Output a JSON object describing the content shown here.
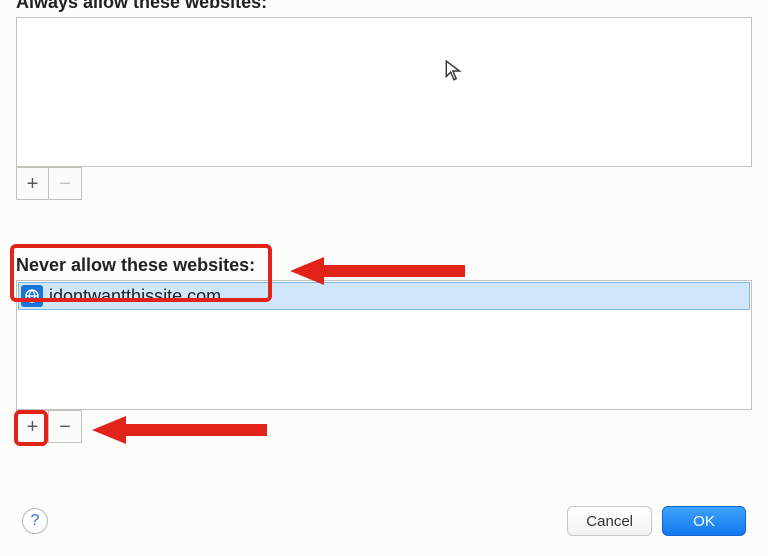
{
  "always": {
    "label": "Always allow these websites:",
    "items": []
  },
  "never": {
    "label": "Never allow these websites:",
    "items": [
      {
        "site": "idontwantthissite.com",
        "selected": true
      }
    ]
  },
  "buttons": {
    "add": "+",
    "remove": "−",
    "cancel": "Cancel",
    "ok": "OK",
    "help": "?"
  }
}
